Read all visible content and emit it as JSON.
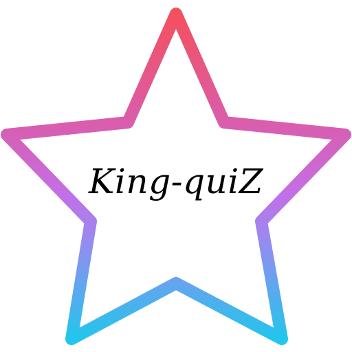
{
  "logo": {
    "title": "King-quiZ",
    "gradient": {
      "top": "#f4505e",
      "upper_mid": "#d85eb0",
      "mid": "#c46fe6",
      "lower_mid": "#8f8ff0",
      "bottom": "#21c6ec"
    }
  }
}
